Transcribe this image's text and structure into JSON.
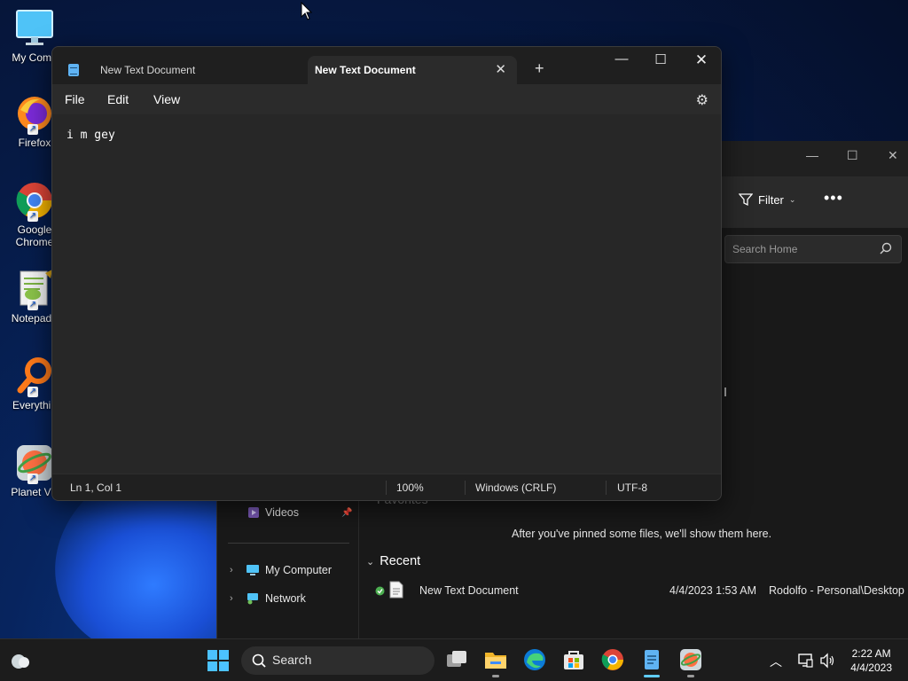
{
  "desktop": {
    "icons": [
      {
        "label": "My Comp",
        "icon": "monitor-icon"
      },
      {
        "label": "Firefox",
        "icon": "firefox-icon"
      },
      {
        "label": "Google Chrome",
        "icon": "chrome-icon"
      },
      {
        "label": "Notepad+",
        "icon": "notepadpp-icon"
      },
      {
        "label": "Everythin",
        "icon": "everything-icon"
      },
      {
        "label": "Planet VP",
        "icon": "planetvpn-icon"
      }
    ]
  },
  "explorer": {
    "filter_label": "Filter",
    "search_placeholder": "Search Home",
    "favorites_label": "Favorites",
    "nav": {
      "videos": "Videos",
      "my_computer": "My Computer",
      "network": "Network"
    },
    "pinned_note": "After you've pinned some files, we'll show them here.",
    "recent_label": "Recent",
    "recent_items": [
      {
        "name": "New Text Document",
        "date": "4/4/2023 1:53 AM",
        "location": "Rodolfo - Personal\\Desktop"
      }
    ]
  },
  "notepad": {
    "tabs": [
      {
        "title": "New Text Document",
        "active": false
      },
      {
        "title": "New Text Document",
        "active": true
      }
    ],
    "menu": {
      "file": "File",
      "edit": "Edit",
      "view": "View"
    },
    "content": "i m gey",
    "status": {
      "position": "Ln 1, Col 1",
      "zoom": "100%",
      "line_ending": "Windows (CRLF)",
      "encoding": "UTF-8"
    }
  },
  "taskbar": {
    "search_label": "Search",
    "time": "2:22 AM",
    "date": "4/4/2023"
  },
  "colors": {
    "accent": "#60cdff",
    "notepad_icon": "#5fb3f3",
    "windows_logo": "#4cc2ff"
  }
}
